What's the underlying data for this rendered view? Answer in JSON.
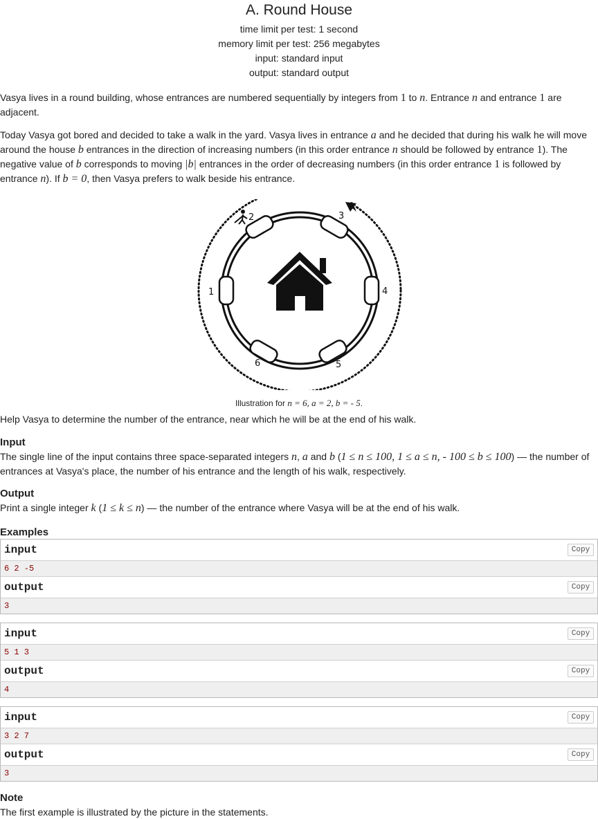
{
  "problem": {
    "title": "A. Round House",
    "time_limit": "time limit per test: 1 second",
    "memory_limit": "memory limit per test: 256 megabytes",
    "input": "input: standard input",
    "output": "output: standard output"
  },
  "statement": {
    "p1_a": "Vasya lives in a round building, whose entrances are numbered sequentially by integers from ",
    "p1_m1": "1",
    "p1_b": " to ",
    "p1_m2": "n",
    "p1_c": ". Entrance ",
    "p1_m3": "n",
    "p1_d": " and entrance ",
    "p1_m4": "1",
    "p1_e": " are adjacent.",
    "p2_a": "Today Vasya got bored and decided to take a walk in the yard. Vasya lives in entrance ",
    "p2_m1": "a",
    "p2_b": " and he decided that during his walk he will move around the house ",
    "p2_m2": "b",
    "p2_c": " entrances in the direction of increasing numbers (in this order entrance ",
    "p2_m3": "n",
    "p2_d": " should be followed by entrance ",
    "p2_m4": "1",
    "p2_e": "). The negative value of ",
    "p2_m5": "b",
    "p2_f": " corresponds to moving ",
    "p2_m6": "|b|",
    "p2_g": " entrances in the order of decreasing numbers (in this order entrance ",
    "p2_m7": "1",
    "p2_h": " is followed by entrance ",
    "p2_m8": "n",
    "p2_i": "). If ",
    "p2_m9": "b = 0",
    "p2_j": ", then Vasya prefers to walk beside his entrance.",
    "caption_a": "Illustration for ",
    "caption_m": "n = 6, a = 2, b =  - 5",
    "caption_b": ".",
    "p3": "Help Vasya to determine the number of the entrance, near which he will be at the end of his walk."
  },
  "figure": {
    "labels": [
      "1",
      "2",
      "3",
      "4",
      "5",
      "6"
    ]
  },
  "input_section": {
    "title": "Input",
    "a": "The single line of the input contains three space-separated integers ",
    "m1": "n",
    "b": ", ",
    "m2": "a",
    "c": " and ",
    "m3": "b",
    "d": " (",
    "m4": "1 ≤ n ≤ 100, 1 ≤ a ≤ n,  - 100 ≤ b ≤ 100",
    "e": ") — the number of entrances at Vasya's place, the number of his entrance and the length of his walk, respectively."
  },
  "output_section": {
    "title": "Output",
    "a": "Print a single integer ",
    "m1": "k",
    "b": " (",
    "m2": "1 ≤ k ≤ n",
    "c": ") — the number of the entrance where Vasya will be at the end of his walk."
  },
  "examples": {
    "title": "Examples",
    "input_label": "input",
    "output_label": "output",
    "copy_label": "Copy",
    "items": [
      {
        "input": "6 2 -5",
        "output": "3"
      },
      {
        "input": "5 1 3",
        "output": "4"
      },
      {
        "input": "3 2 7",
        "output": "3"
      }
    ]
  },
  "note": {
    "title": "Note",
    "text": "The first example is illustrated by the picture in the statements."
  }
}
